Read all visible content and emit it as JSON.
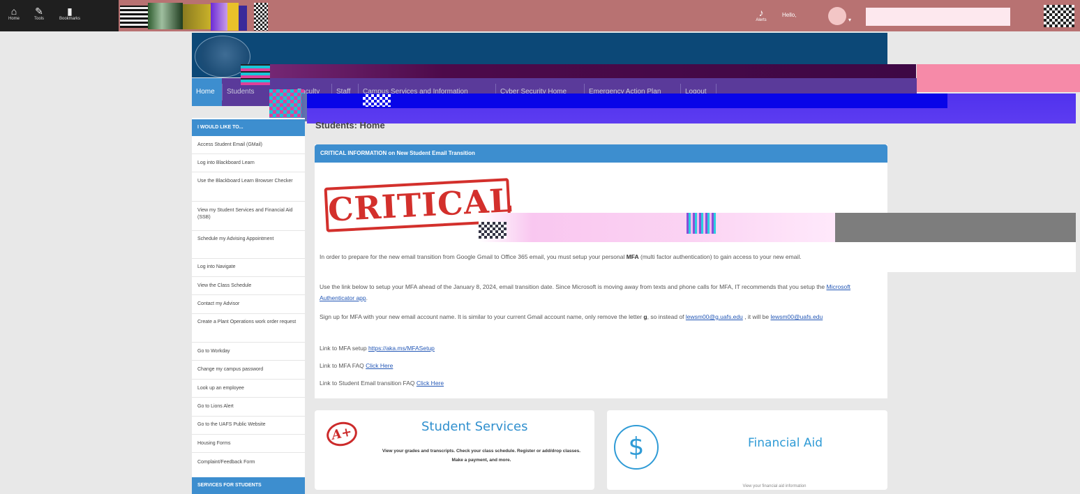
{
  "toolbar": {
    "home_label": "Home",
    "tools_label": "Tools",
    "bookmarks_label": "Bookmarks",
    "notifications_label": "Alerts",
    "hello_label": "Hello,",
    "search_placeholder": ""
  },
  "nav": {
    "items": [
      {
        "label": "Home"
      },
      {
        "label": "Students"
      },
      {
        "label": "Faculty"
      },
      {
        "label": "Staff"
      },
      {
        "label": "Campus Services and Information"
      },
      {
        "label": "Cyber Security Home"
      },
      {
        "label": "Emergency Action Plan"
      },
      {
        "label": "Logout"
      }
    ]
  },
  "sidebar": {
    "heading": "I WOULD LIKE TO...",
    "links": [
      "Access Student Email (GMail)",
      "Log into Blackboard Learn",
      "Use the Blackboard Learn Browser Checker",
      "View my Student Services and Financial Aid (SSB)",
      "Schedule my Advising Appointment",
      "Log into Navigate",
      "View the Class Schedule",
      "Contact my Advisor",
      "Create a Plant Operations work order request",
      "Go to Workday",
      "Change my campus password",
      "Look up an employee",
      "Go to Lions Alert",
      "Go to the UAFS Public Website",
      "Housing Forms",
      "Complaint/Feedback Form"
    ],
    "heading2": "SERVICES FOR STUDENTS"
  },
  "main": {
    "title": "Students: Home",
    "critical": {
      "heading": "CRITICAL INFORMATION on New Student Email Transition",
      "stamp": "CRITICAL",
      "p1_start": "In order to prepare for the new email transition from Google Gmail to Office 365 email, you must setup your personal ",
      "p1_bold": "MFA",
      "p1_end": " (multi factor authentication) to gain access to your new email.",
      "p2_start": "Use the link below to setup your MFA ahead of the January 8, 2024, email transition date. Since Microsoft is moving away from texts and phone calls for MFA, IT recommends that you setup the ",
      "p2_link": "Microsoft Authenticator app",
      "p2_end": ".",
      "p3_start": "Sign up for MFA with your new email account name. It is similar to your current Gmail account name, only remove the letter ",
      "p3_bold": "g",
      "p3_mid": ", so instead of ",
      "p3_link1": "lewsm00@g.uafs.edu",
      "p3_mid2": " , it will be ",
      "p3_link2": "lewsm00@uafs.edu",
      "p4_label": "Link to MFA setup ",
      "p4_link": "https://aka.ms/MFASetup",
      "p5_label": "Link to MFA FAQ ",
      "p5_link": "Click Here",
      "p6_label": "Link to Student Email transition FAQ  ",
      "p6_link": "Click Here"
    },
    "student_services": {
      "title": "Student Services",
      "grade": "A+",
      "desc": "View your grades and transcripts. Check your class schedule. Register or add/drop classes. Make a payment, and more."
    },
    "financial_aid": {
      "title": "Financial Aid",
      "symbol": "$",
      "desc": "View your financial aid information"
    }
  },
  "colors": {
    "toolbar": "#b87272",
    "banner": "#0c4877",
    "accent_blue": "#3d8ecf",
    "critical_red": "#d3302c",
    "link": "#2357b6"
  }
}
